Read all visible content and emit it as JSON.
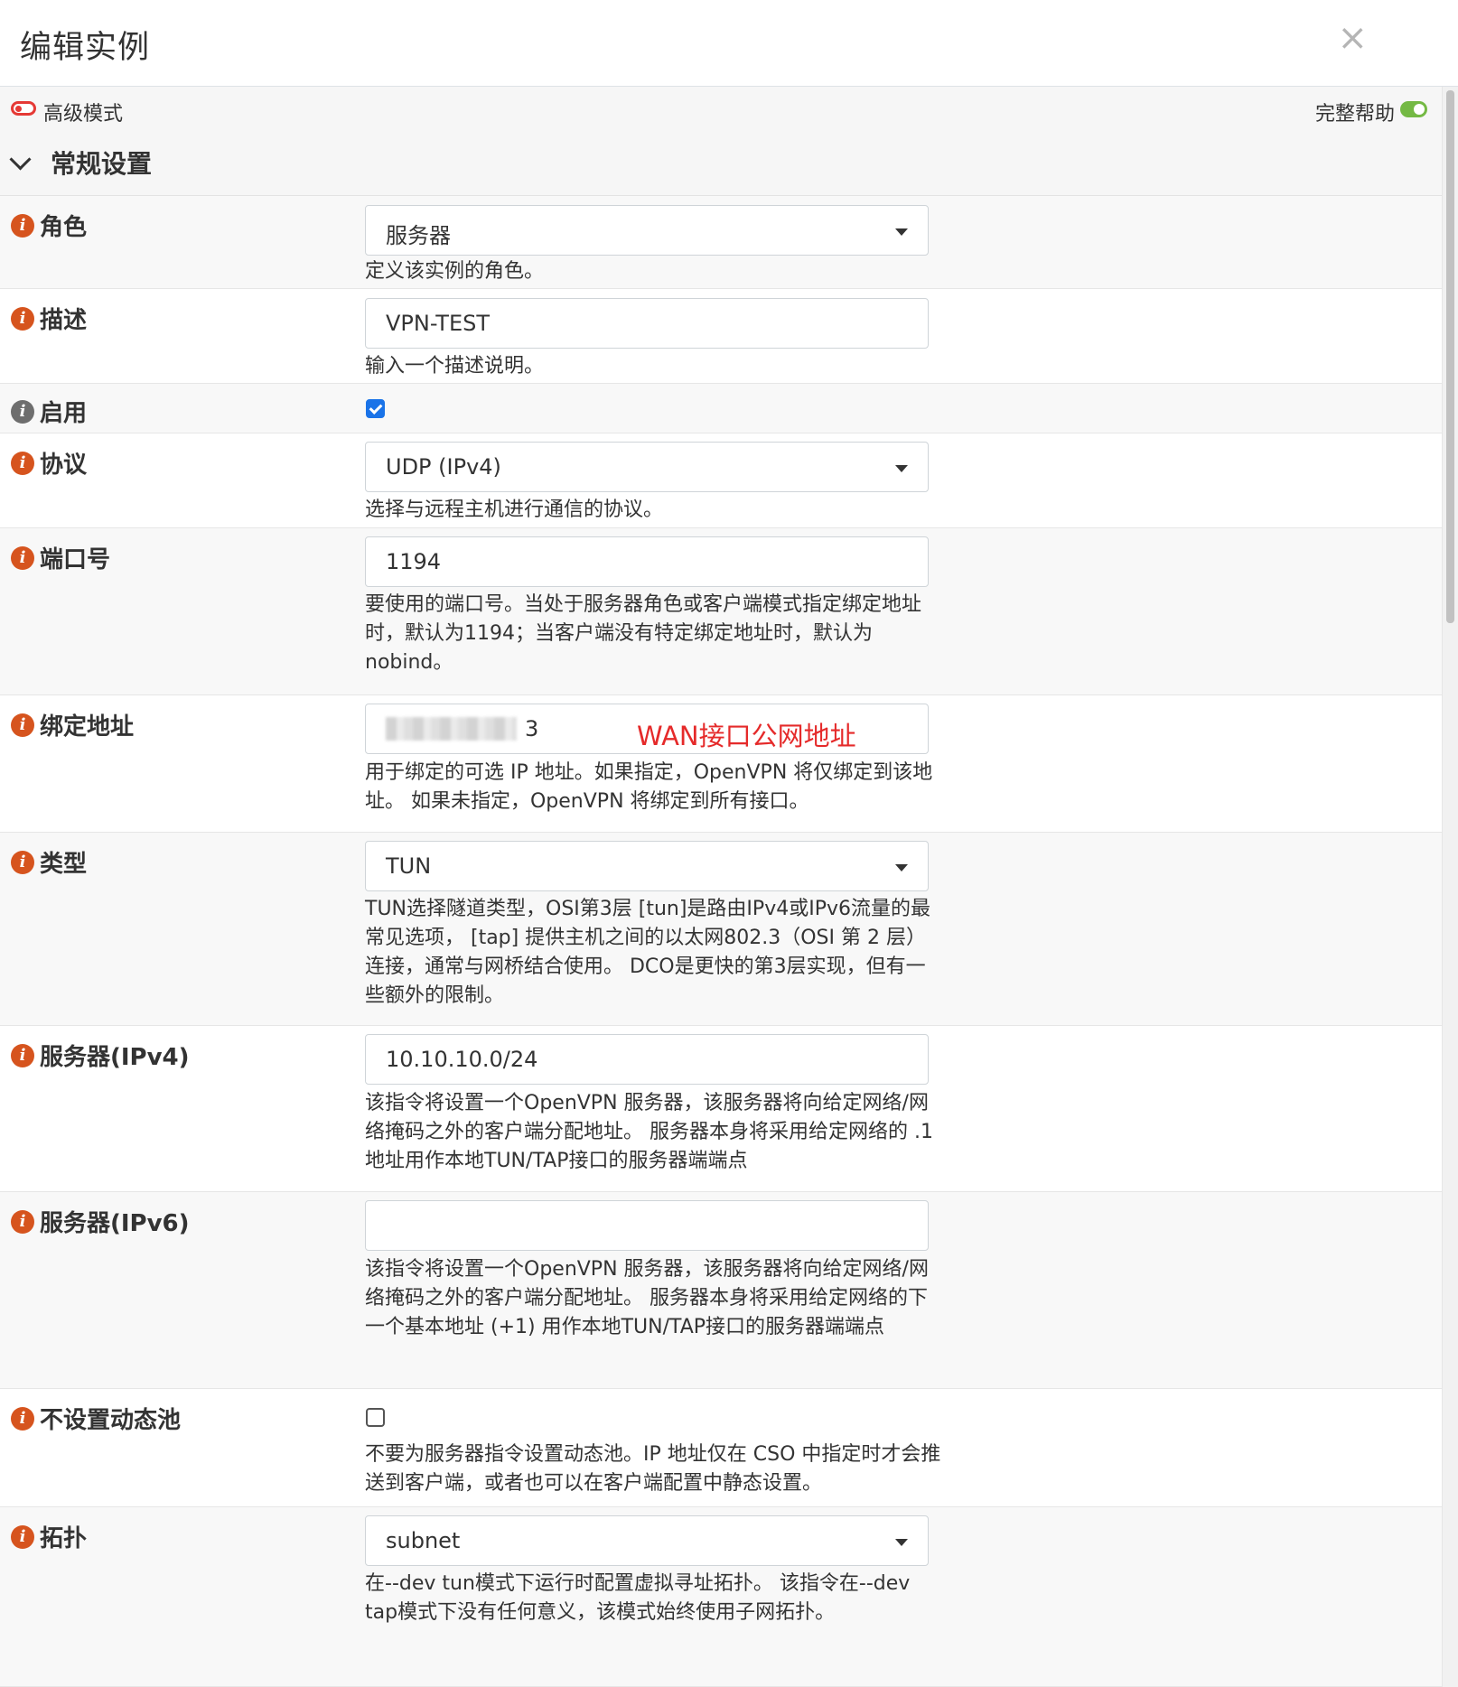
{
  "dialog": {
    "title": "编辑实例",
    "close_symbol": "×"
  },
  "toolbar": {
    "advanced_mode_label": "高级模式",
    "full_help_label": "完整帮助"
  },
  "section": {
    "title": "常规设置"
  },
  "fields": {
    "role": {
      "label": "角色",
      "value": "服务器",
      "help": "定义该实例的角色。"
    },
    "description": {
      "label": "描述",
      "value": "VPN-TEST",
      "help": "输入一个描述说明。"
    },
    "enabled": {
      "label": "启用",
      "checked": true
    },
    "protocol": {
      "label": "协议",
      "value": "UDP (IPv4)",
      "help": "选择与远程主机进行通信的协议。"
    },
    "port": {
      "label": "端口号",
      "value": "1194",
      "help": "要使用的端口号。当处于服务器角色或客户端模式指定绑定地址时，默认为1194；当客户端没有特定绑定地址时，默认为nobind。"
    },
    "bind_address": {
      "label": "绑定地址",
      "value_tail": "3",
      "annotation": "WAN接口公网地址",
      "help": "用于绑定的可选 IP 地址。如果指定，OpenVPN 将仅绑定到该地址。 如果未指定，OpenVPN 将绑定到所有接口。"
    },
    "type": {
      "label": "类型",
      "value": "TUN",
      "help": "TUN选择隧道类型，OSI第3层 [tun]是路由IPv4或IPv6流量的最常见选项， [tap] 提供主机之间的以太网802.3（OSI 第 2 层）连接，通常与网桥结合使用。 DCO是更快的第3层实现，但有一些额外的限制。"
    },
    "server_ipv4": {
      "label": "服务器(IPv4)",
      "value": "10.10.10.0/24",
      "help": "该指令将设置一个OpenVPN 服务器，该服务器将向给定网络/网络掩码之外的客户端分配地址。 服务器本身将采用给定网络的 .1 地址用作本地TUN/TAP接口的服务器端端点"
    },
    "server_ipv6": {
      "label": "服务器(IPv6)",
      "value": "",
      "help": "该指令将设置一个OpenVPN 服务器，该服务器将向给定网络/网络掩码之外的客户端分配地址。 服务器本身将采用给定网络的下一个基本地址 (+1) 用作本地TUN/TAP接口的服务器端端点"
    },
    "no_pool": {
      "label": "不设置动态池",
      "checked": false,
      "help": "不要为服务器指令设置动态池。IP 地址仅在 CSO 中指定时才会推送到客户端，或者也可以在客户端配置中静态设置。"
    },
    "topology": {
      "label": "拓扑",
      "value": "subnet",
      "help": "在--dev tun模式下运行时配置虚拟寻址拓扑。 该指令在--dev tap模式下没有任何意义，该模式始终使用子网拓扑。"
    }
  },
  "colors": {
    "info_icon": "#d6541e",
    "info_icon_grey": "#6e6e6e",
    "advanced_toggle_off": "#e53935",
    "help_toggle_on": "#74b944",
    "checkbox_checked": "#1a73e8",
    "annotation": "#e52a2a"
  },
  "icons": {
    "info": "info-icon",
    "close": "close-icon",
    "chevron": "chevron-down-icon",
    "dropdown": "caret-down-icon"
  }
}
